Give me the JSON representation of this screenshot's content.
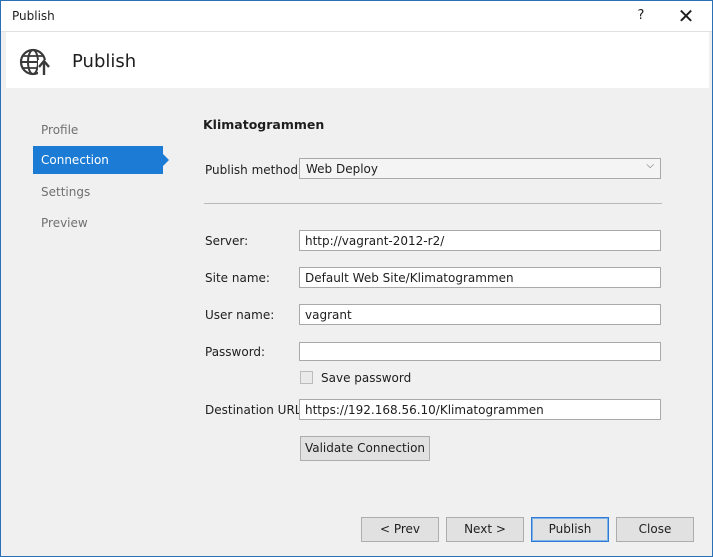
{
  "window": {
    "title": "Publish",
    "help_glyph": "?",
    "close_glyph": "✕"
  },
  "header": {
    "icon": "globe-publish-icon",
    "title": "Publish"
  },
  "nav": {
    "items": [
      {
        "label": "Profile",
        "active": false
      },
      {
        "label": "Connection",
        "active": true
      },
      {
        "label": "Settings",
        "active": false
      },
      {
        "label": "Preview",
        "active": false
      }
    ]
  },
  "form": {
    "profile_name": "Klimatogrammen",
    "publish_method": {
      "label": "Publish method:",
      "value": "Web Deploy"
    },
    "server": {
      "label": "Server:",
      "value": "http://vagrant-2012-r2/"
    },
    "site_name": {
      "label": "Site name:",
      "value": "Default Web Site/Klimatogrammen"
    },
    "user_name": {
      "label": "User name:",
      "value": "vagrant"
    },
    "password": {
      "label": "Password:",
      "value": ""
    },
    "save_password": {
      "label": "Save password",
      "checked": false
    },
    "destination_url": {
      "label": "Destination URL:",
      "value": "https://192.168.56.10/Klimatogrammen"
    },
    "validate_label": "Validate Connection"
  },
  "footer": {
    "prev": "< Prev",
    "next": "Next >",
    "publish": "Publish",
    "close": "Close"
  },
  "colors": {
    "accent": "#1c7bd4",
    "window_border": "#2b6fb5",
    "background": "#f0f0f0"
  }
}
